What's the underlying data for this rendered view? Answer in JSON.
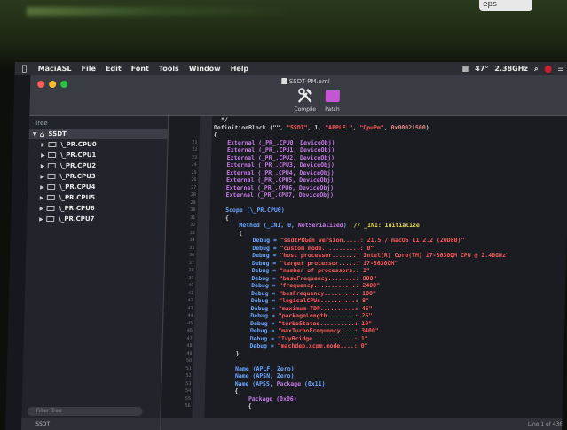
{
  "environment": {
    "sticker_text": "eps"
  },
  "menubar": {
    "app": "MaciASL",
    "items": [
      "File",
      "Edit",
      "Font",
      "Tools",
      "Window",
      "Help"
    ],
    "status": {
      "temp": "47°",
      "cpu": "2.38GHz"
    }
  },
  "window": {
    "title": "SSDT-PM.aml",
    "toolbar": {
      "compile_label": "Compile",
      "patch_label": "Patch"
    }
  },
  "sidebar": {
    "header": "Tree",
    "root": "SSDT",
    "items": [
      "\\_PR.CPU0",
      "\\_PR.CPU1",
      "\\_PR.CPU2",
      "\\_PR.CPU3",
      "\\_PR.CPU4",
      "\\_PR.CPU5",
      "\\_PR.CPU6",
      "\\_PR.CPU7"
    ],
    "filter_placeholder": "Filter Tree",
    "footer": "SSDT"
  },
  "code": {
    "lines": [
      {
        "n": "",
        "segs": [
          [
            "pl",
            "  */"
          ]
        ]
      },
      {
        "n": "",
        "segs": [
          [
            "pl",
            "DefinitionBlock (\"\", "
          ],
          [
            "st",
            "\"SSDT\""
          ],
          [
            "pl",
            ", 1, "
          ],
          [
            "st",
            "\"APPLE \""
          ],
          [
            "pl",
            ", "
          ],
          [
            "st",
            "\"CpuPm\""
          ],
          [
            "pl",
            ", "
          ],
          [
            "num",
            "0x00021500"
          ],
          [
            "pl",
            ")"
          ]
        ]
      },
      {
        "n": "",
        "segs": [
          [
            "pl",
            "{"
          ]
        ]
      },
      {
        "n": "21",
        "segs": [
          [
            "ex",
            "    External (_PR_.CPU0, DeviceObj)"
          ]
        ]
      },
      {
        "n": "22",
        "segs": [
          [
            "ex",
            "    External (_PR_.CPU1, DeviceObj)"
          ]
        ]
      },
      {
        "n": "23",
        "segs": [
          [
            "ex",
            "    External (_PR_.CPU2, DeviceObj)"
          ]
        ]
      },
      {
        "n": "24",
        "segs": [
          [
            "ex",
            "    External (_PR_.CPU3, DeviceObj)"
          ]
        ]
      },
      {
        "n": "25",
        "segs": [
          [
            "ex",
            "    External (_PR_.CPU4, DeviceObj)"
          ]
        ]
      },
      {
        "n": "26",
        "segs": [
          [
            "ex",
            "    External (_PR_.CPU5, DeviceObj)"
          ]
        ]
      },
      {
        "n": "27",
        "segs": [
          [
            "ex",
            "    External (_PR_.CPU6, DeviceObj)"
          ]
        ]
      },
      {
        "n": "28",
        "segs": [
          [
            "ex",
            "    External (_PR_.CPU7, DeviceObj)"
          ]
        ]
      },
      {
        "n": "29",
        "segs": [
          [
            "pl",
            ""
          ]
        ]
      },
      {
        "n": "30",
        "segs": [
          [
            "kw",
            "    Scope (\\_PR.CPU0)"
          ]
        ]
      },
      {
        "n": "31",
        "segs": [
          [
            "pl",
            "    {"
          ]
        ]
      },
      {
        "n": "32",
        "segs": [
          [
            "kw",
            "        Method (_INI, 0, "
          ],
          [
            "ex",
            "NotSerialized"
          ],
          [
            "kw",
            ")"
          ],
          [
            "cm",
            "  // _INI: Initialize"
          ]
        ]
      },
      {
        "n": "33",
        "segs": [
          [
            "pl",
            "        {"
          ]
        ]
      },
      {
        "n": "34",
        "segs": [
          [
            "kw",
            "            Debug = "
          ],
          [
            "st",
            "\"ssdtPRGen version.....: 21.5 / macOS 11.2.2 (20D80)\""
          ]
        ]
      },
      {
        "n": "35",
        "segs": [
          [
            "kw",
            "            Debug = "
          ],
          [
            "st",
            "\"custom mode...........: 0\""
          ]
        ]
      },
      {
        "n": "36",
        "segs": [
          [
            "kw",
            "            Debug = "
          ],
          [
            "st",
            "\"host processor.......: Intel(R) Core(TM) i7-3630QM CPU @ 2.40GHz\""
          ]
        ]
      },
      {
        "n": "37",
        "segs": [
          [
            "kw",
            "            Debug = "
          ],
          [
            "st",
            "\"target processor.....: i7-3630QM\""
          ]
        ]
      },
      {
        "n": "38",
        "segs": [
          [
            "kw",
            "            Debug = "
          ],
          [
            "st",
            "\"number of processors.: 1\""
          ]
        ]
      },
      {
        "n": "39",
        "segs": [
          [
            "kw",
            "            Debug = "
          ],
          [
            "st",
            "\"baseFrequency........: 800\""
          ]
        ]
      },
      {
        "n": "40",
        "segs": [
          [
            "kw",
            "            Debug = "
          ],
          [
            "st",
            "\"frequency............: 2400\""
          ]
        ]
      },
      {
        "n": "41",
        "segs": [
          [
            "kw",
            "            Debug = "
          ],
          [
            "st",
            "\"busFrequency.........: 100\""
          ]
        ]
      },
      {
        "n": "42",
        "segs": [
          [
            "kw",
            "            Debug = "
          ],
          [
            "st",
            "\"logicalCPUs..........: 8\""
          ]
        ]
      },
      {
        "n": "43",
        "segs": [
          [
            "kw",
            "            Debug = "
          ],
          [
            "st",
            "\"maximum TDP..........: 45\""
          ]
        ]
      },
      {
        "n": "44",
        "segs": [
          [
            "kw",
            "            Debug = "
          ],
          [
            "st",
            "\"packageLength........: 25\""
          ]
        ]
      },
      {
        "n": "45",
        "segs": [
          [
            "kw",
            "            Debug = "
          ],
          [
            "st",
            "\"turboStates..........: 10\""
          ]
        ]
      },
      {
        "n": "46",
        "segs": [
          [
            "kw",
            "            Debug = "
          ],
          [
            "st",
            "\"maxTurboFrequency....: 3400\""
          ]
        ]
      },
      {
        "n": "47",
        "segs": [
          [
            "kw",
            "            Debug = "
          ],
          [
            "st",
            "\"IvyBridge............: 1\""
          ]
        ]
      },
      {
        "n": "48",
        "segs": [
          [
            "kw",
            "            Debug = "
          ],
          [
            "st",
            "\"machdep.xcpm.mode....: 0\""
          ]
        ]
      },
      {
        "n": "49",
        "segs": [
          [
            "pl",
            "        }"
          ]
        ]
      },
      {
        "n": "50",
        "segs": [
          [
            "pl",
            ""
          ]
        ]
      },
      {
        "n": "51",
        "segs": [
          [
            "kw",
            "        Name (APLF, Zero)"
          ]
        ]
      },
      {
        "n": "52",
        "segs": [
          [
            "kw",
            "        Name (APSN, Zero)"
          ]
        ]
      },
      {
        "n": "53",
        "segs": [
          [
            "kw",
            "        Name (APSS, "
          ],
          [
            "ex",
            "Package"
          ],
          [
            "kw",
            " (0x11)"
          ]
        ]
      },
      {
        "n": "54",
        "segs": [
          [
            "pl",
            "        {"
          ]
        ]
      },
      {
        "n": "55",
        "segs": [
          [
            "ex",
            "            Package (0x06)"
          ]
        ]
      },
      {
        "n": "56",
        "segs": [
          [
            "pl",
            "            {"
          ]
        ]
      }
    ]
  },
  "editor_footer": "Line 1 of 436"
}
